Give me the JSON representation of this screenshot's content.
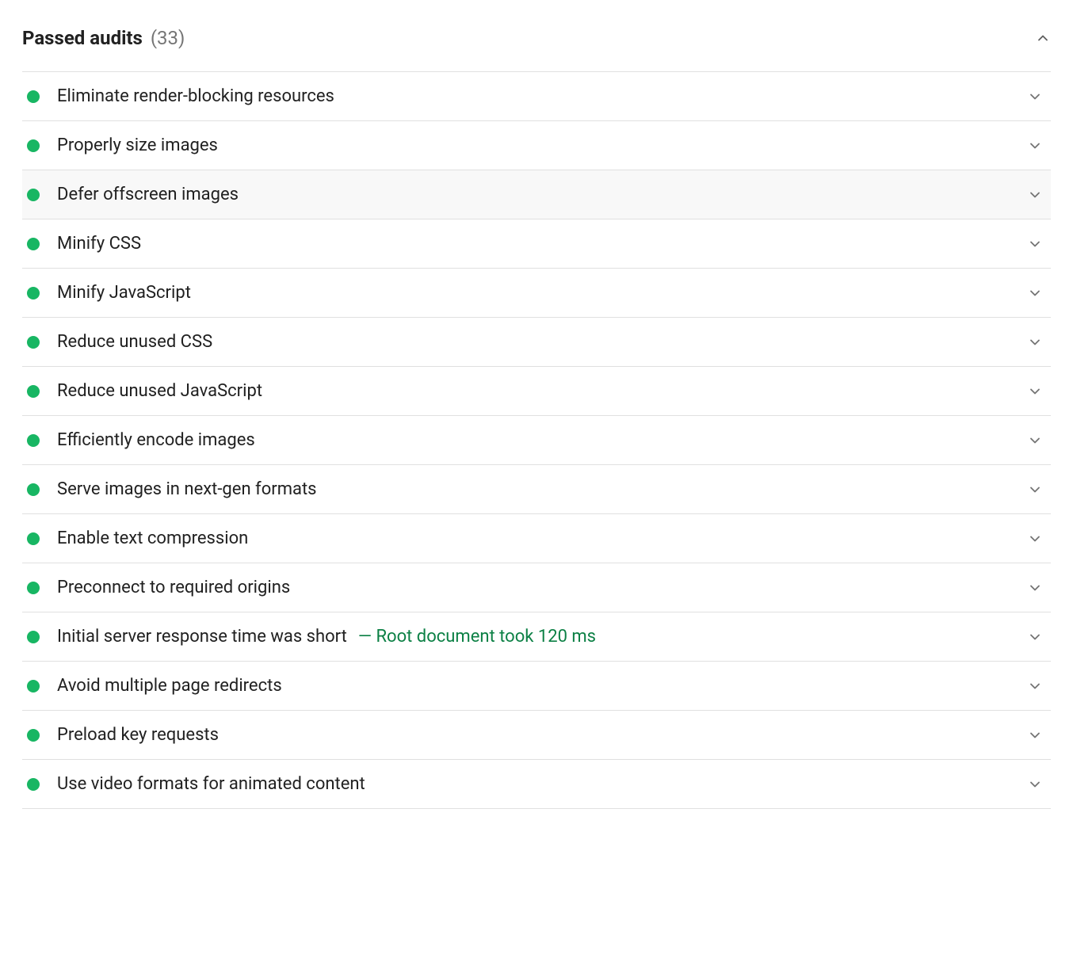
{
  "header": {
    "title": "Passed audits",
    "count": "(33)"
  },
  "colors": {
    "pass": "#18b663",
    "detail": "#0c8045"
  },
  "audits": [
    {
      "label": "Eliminate render-blocking resources",
      "detail": "",
      "highlight": false
    },
    {
      "label": "Properly size images",
      "detail": "",
      "highlight": false
    },
    {
      "label": "Defer offscreen images",
      "detail": "",
      "highlight": true
    },
    {
      "label": "Minify CSS",
      "detail": "",
      "highlight": false
    },
    {
      "label": "Minify JavaScript",
      "detail": "",
      "highlight": false
    },
    {
      "label": "Reduce unused CSS",
      "detail": "",
      "highlight": false
    },
    {
      "label": "Reduce unused JavaScript",
      "detail": "",
      "highlight": false
    },
    {
      "label": "Efficiently encode images",
      "detail": "",
      "highlight": false
    },
    {
      "label": "Serve images in next-gen formats",
      "detail": "",
      "highlight": false
    },
    {
      "label": "Enable text compression",
      "detail": "",
      "highlight": false
    },
    {
      "label": "Preconnect to required origins",
      "detail": "",
      "highlight": false
    },
    {
      "label": "Initial server response time was short",
      "detail": "— Root document took 120 ms",
      "highlight": false
    },
    {
      "label": "Avoid multiple page redirects",
      "detail": "",
      "highlight": false
    },
    {
      "label": "Preload key requests",
      "detail": "",
      "highlight": false
    },
    {
      "label": "Use video formats for animated content",
      "detail": "",
      "highlight": false
    }
  ]
}
